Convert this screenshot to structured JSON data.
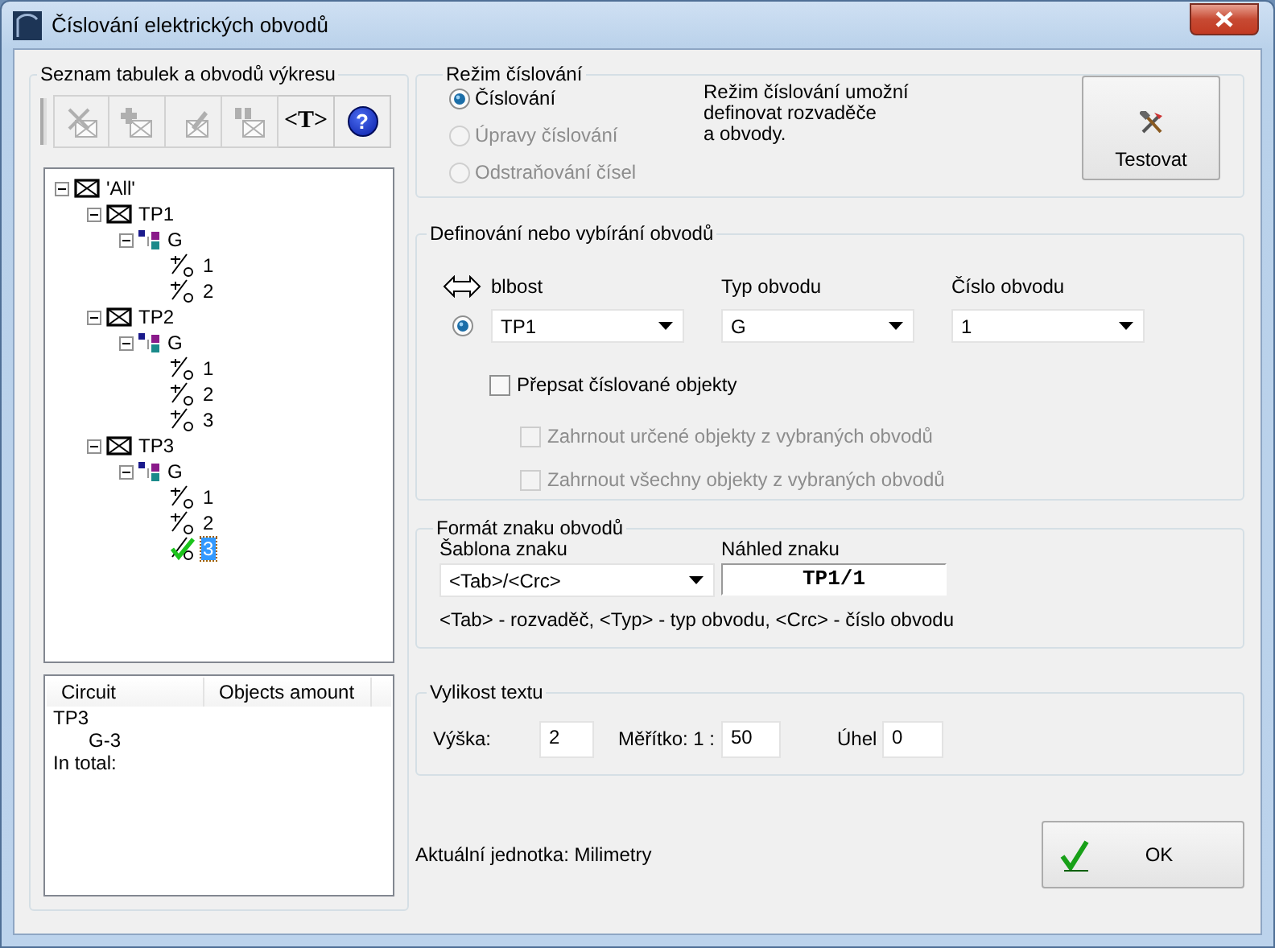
{
  "window": {
    "title": "Číslování elektrických obvodů"
  },
  "drawing_list": {
    "title": "Seznam tabulek a obvodů výkresu",
    "toolbar": [
      {
        "kind": "delete",
        "disabled": true
      },
      {
        "kind": "add",
        "disabled": true
      },
      {
        "kind": "edit",
        "disabled": true
      },
      {
        "kind": "find",
        "disabled": true
      },
      {
        "kind": "text",
        "label": "<T>",
        "disabled": false
      },
      {
        "kind": "help",
        "label": "?",
        "disabled": false
      }
    ],
    "tree": [
      {
        "label": "'All'",
        "kind": "table",
        "expanded": true,
        "selected": false,
        "children": [
          {
            "label": "TP1",
            "kind": "table",
            "expanded": true,
            "selected": false,
            "children": [
              {
                "label": "G",
                "kind": "type",
                "expanded": true,
                "selected": false,
                "children": [
                  {
                    "label": "1",
                    "kind": "circuit",
                    "checked": false,
                    "selected": false
                  },
                  {
                    "label": "2",
                    "kind": "circuit",
                    "checked": false,
                    "selected": false
                  }
                ]
              }
            ]
          },
          {
            "label": "TP2",
            "kind": "table",
            "expanded": true,
            "selected": false,
            "children": [
              {
                "label": "G",
                "kind": "type",
                "expanded": true,
                "selected": false,
                "children": [
                  {
                    "label": "1",
                    "kind": "circuit",
                    "checked": false,
                    "selected": false
                  },
                  {
                    "label": "2",
                    "kind": "circuit",
                    "checked": false,
                    "selected": false
                  },
                  {
                    "label": "3",
                    "kind": "circuit",
                    "checked": false,
                    "selected": false
                  }
                ]
              }
            ]
          },
          {
            "label": "TP3",
            "kind": "table",
            "expanded": true,
            "selected": false,
            "children": [
              {
                "label": "G",
                "kind": "type",
                "expanded": true,
                "selected": false,
                "children": [
                  {
                    "label": "1",
                    "kind": "circuit",
                    "checked": false,
                    "selected": false
                  },
                  {
                    "label": "2",
                    "kind": "circuit",
                    "checked": false,
                    "selected": false
                  },
                  {
                    "label": "3",
                    "kind": "circuit",
                    "checked": true,
                    "selected": true
                  }
                ]
              }
            ]
          }
        ]
      }
    ],
    "summary": {
      "columns": [
        "Circuit",
        "Objects amount"
      ],
      "rows": [
        {
          "circuit": "TP3",
          "children": [
            {
              "circuit": "G-3"
            }
          ]
        },
        {
          "circuit": "In total:"
        }
      ]
    }
  },
  "mode": {
    "title": "Režim číslování",
    "options": [
      {
        "label": "Číslování",
        "selected": true,
        "disabled": false
      },
      {
        "label": "Úpravy číslování",
        "selected": false,
        "disabled": true
      },
      {
        "label": "Odstraňování čísel",
        "selected": false,
        "disabled": true
      }
    ],
    "description": "Režim číslování umožní\ndefinovat rozvaděče\na obvody.",
    "test_button": "Testovat"
  },
  "define": {
    "title": "Definování nebo vybírání obvodů",
    "fields": [
      {
        "label": "blbost",
        "value": "TP1"
      },
      {
        "label": "Typ obvodu",
        "value": "G"
      },
      {
        "label": "Číslo obvodu",
        "value": "1"
      }
    ],
    "row_selected": true,
    "checkboxes": [
      {
        "label": "Přepsat číslované objekty",
        "checked": false,
        "disabled": false,
        "children": [
          {
            "label": "Zahrnout určené objekty z vybraných obvodů",
            "checked": false,
            "disabled": true
          },
          {
            "label": "Zahrnout všechny objekty z vybraných obvodů",
            "checked": false,
            "disabled": true
          }
        ]
      }
    ]
  },
  "format": {
    "title": "Formát znaku obvodů",
    "template_label": "Šablona znaku",
    "template_value": "<Tab>/<Crc>",
    "preview_label": "Náhled znaku",
    "preview_value": "TP1/1",
    "hint": "<Tab> - rozvaděč, <Typ> - typ obvodu, <Crc> - číslo obvodu"
  },
  "text_size": {
    "title": "Vylikost textu",
    "fields": [
      {
        "label": "Výška:",
        "value": "2"
      },
      {
        "label": "Měřítko: 1 :",
        "value": "50"
      },
      {
        "label": "Úhel",
        "value": "0"
      }
    ]
  },
  "footer": {
    "unit": "Aktuální jednotka: Milimetry",
    "ok_button": "OK"
  }
}
